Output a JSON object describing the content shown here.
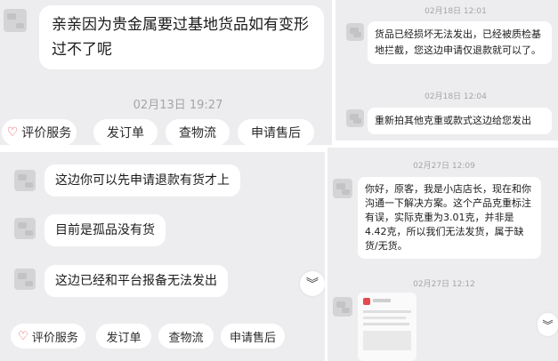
{
  "panel1": {
    "message": "亲亲因为贵金属要过基地货品如有变形过不了呢",
    "timestamp": "02月13日 19:27",
    "actions": [
      "评价服务",
      "发订单",
      "查物流",
      "申请售后"
    ]
  },
  "panel2": {
    "time1": "02月18日 12:01",
    "message1": "货品已经损坏无法发出，已经被质检基地拦截，您这边申请仅退款就可以了。",
    "time2": "02月18日 12:04",
    "message2": "重新拍其他克重或款式这边给您发出"
  },
  "panel3": {
    "messages": [
      "这边你可以先申请退款有货才上",
      "目前是孤品没有货",
      "这边已经和平台报备无法发出"
    ],
    "actions": [
      "评价服务",
      "发订单",
      "查物流",
      "申请售后"
    ]
  },
  "panel4": {
    "time1": "02月27日 12:09",
    "message1": "你好，原客，我是小店店长，现在和你沟通一下解决方案。这个产品克重标注有误，实际克重为3.01克，并非是4.42克，所以我们无法发货，属于缺货/无货。",
    "time2": "02月27日 12:12"
  },
  "icons": {
    "heart": "heart-icon",
    "chevron": "chevron-down-icon"
  },
  "colors": {
    "panel_bg": "#ededef",
    "bubble_bg": "#ffffff",
    "accent": "#e8474d"
  }
}
